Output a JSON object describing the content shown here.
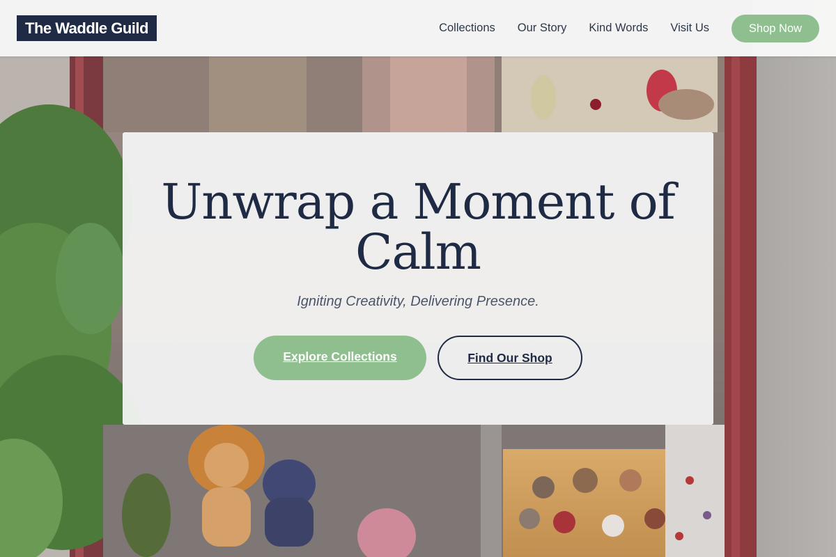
{
  "header": {
    "logo": "The Waddle Guild",
    "nav": [
      {
        "label": "Collections"
      },
      {
        "label": "Our Story"
      },
      {
        "label": "Kind Words"
      },
      {
        "label": "Visit Us"
      }
    ],
    "cta_label": "Shop Now"
  },
  "hero": {
    "headline_line1": "Unwrap a Moment of",
    "headline_line2": "Calm",
    "tagline": "Igniting Creativity, Delivering Presence.",
    "primary_button": "Explore Collections",
    "secondary_button": "Find Our Shop"
  },
  "colors": {
    "navy": "#1f2a44",
    "sage": "#8fbe8f",
    "card_bg": "#f6f6f6"
  }
}
